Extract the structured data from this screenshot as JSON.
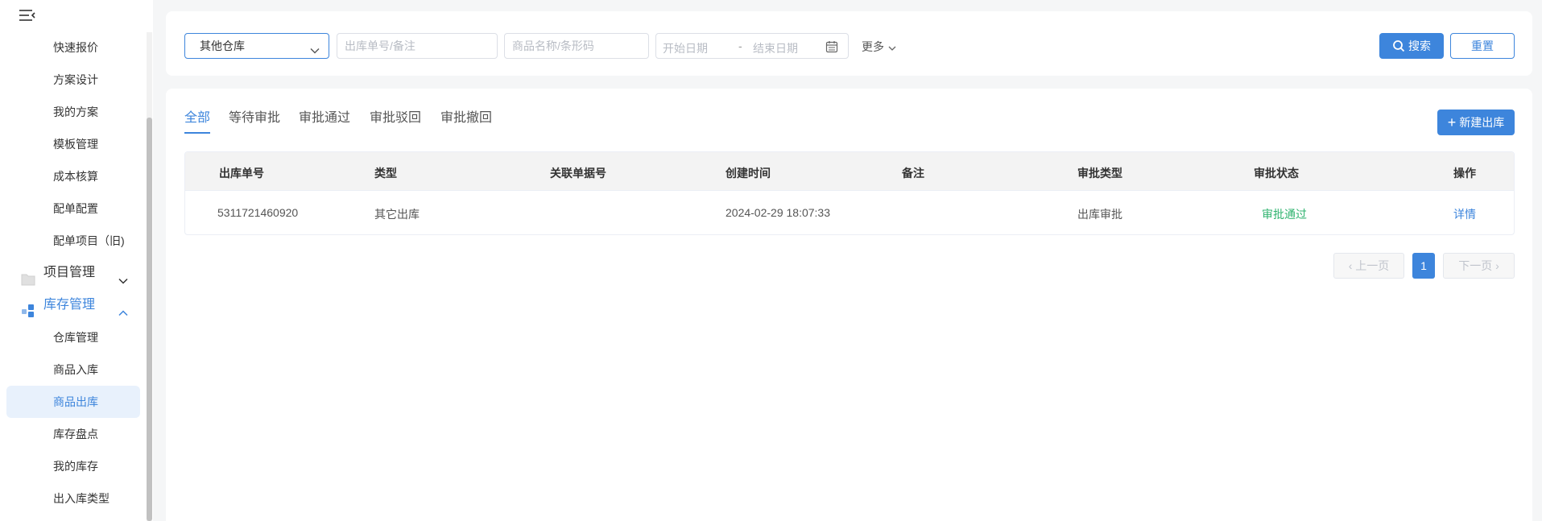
{
  "sidebar": {
    "sub_items_top": [
      {
        "label": "快速报价"
      },
      {
        "label": "方案设计"
      },
      {
        "label": "我的方案"
      },
      {
        "label": "模板管理"
      },
      {
        "label": "成本核算"
      },
      {
        "label": "配单配置"
      },
      {
        "label": "配单项目（旧)"
      }
    ],
    "groups": [
      {
        "label": "项目管理",
        "expanded": false
      },
      {
        "label": "库存管理",
        "expanded": true
      }
    ],
    "sub_items_inventory": [
      {
        "label": "仓库管理",
        "active": false
      },
      {
        "label": "商品入库",
        "active": false
      },
      {
        "label": "商品出库",
        "active": true
      },
      {
        "label": "库存盘点",
        "active": false
      },
      {
        "label": "我的库存",
        "active": false
      },
      {
        "label": "出入库类型",
        "active": false
      }
    ]
  },
  "filters": {
    "warehouse_value": "其他仓库",
    "order_placeholder": "出库单号/备注",
    "goods_placeholder": "商品名称/条形码",
    "start_date_placeholder": "开始日期",
    "date_separator": "-",
    "end_date_placeholder": "结束日期",
    "more_label": "更多",
    "search_label": "搜索",
    "reset_label": "重置"
  },
  "tabs": [
    {
      "label": "全部",
      "active": true
    },
    {
      "label": "等待审批",
      "active": false
    },
    {
      "label": "审批通过",
      "active": false
    },
    {
      "label": "审批驳回",
      "active": false
    },
    {
      "label": "审批撤回",
      "active": false
    }
  ],
  "new_button_label": "新建出库",
  "table": {
    "columns": [
      "出库单号",
      "类型",
      "关联单据号",
      "创建时间",
      "备注",
      "审批类型",
      "审批状态",
      "操作"
    ],
    "rows": [
      {
        "order_no": "5311721460920",
        "type": "其它出库",
        "related_no": "",
        "created_at": "2024-02-29 18:07:33",
        "remark": "",
        "approval_type": "出库审批",
        "approval_status": "审批通过",
        "action": "详情"
      }
    ]
  },
  "pagination": {
    "prev_label": "上一页",
    "current_page": "1",
    "next_label": "下一页"
  },
  "colors": {
    "accent": "#3d85dc",
    "success": "#2fb36f"
  }
}
